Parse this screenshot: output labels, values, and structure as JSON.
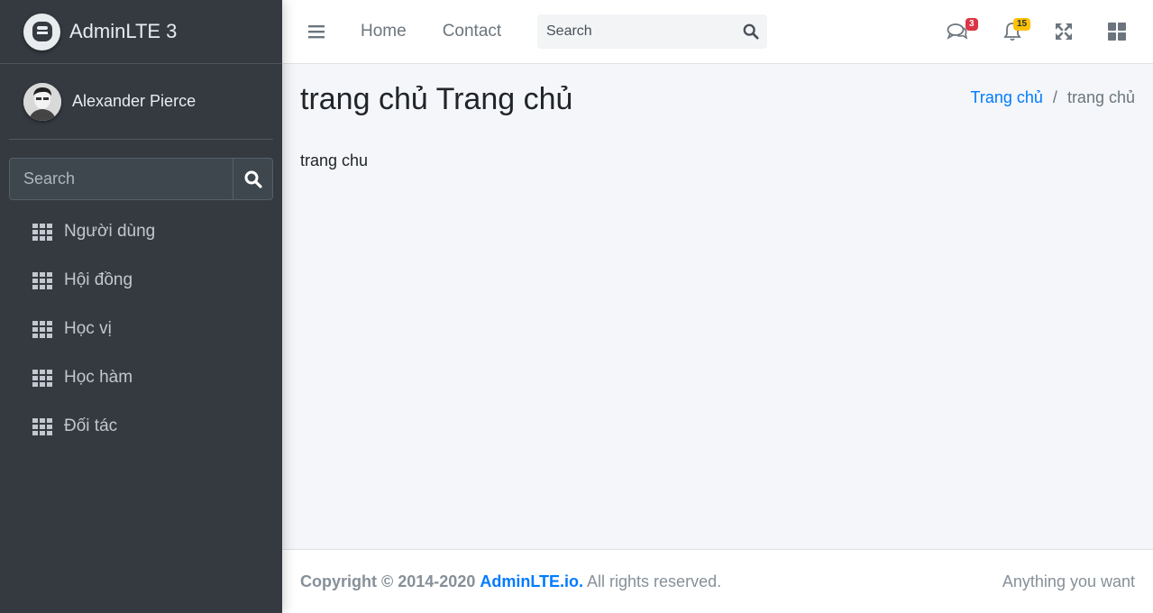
{
  "sidebar": {
    "brand": "AdminLTE 3",
    "user_name": "Alexander Pierce",
    "search_placeholder": "Search",
    "items": [
      {
        "label": "Người dùng",
        "icon": "grid-icon"
      },
      {
        "label": "Hội đồng",
        "icon": "grid-icon"
      },
      {
        "label": "Học vị",
        "icon": "grid-icon"
      },
      {
        "label": "Học hàm",
        "icon": "grid-icon"
      },
      {
        "label": "Đối tác",
        "icon": "grid-icon"
      }
    ]
  },
  "navbar": {
    "links": [
      "Home",
      "Contact"
    ],
    "search_placeholder": "Search",
    "messages_count": "3",
    "notifications_count": "15"
  },
  "content": {
    "title": "trang chủ Trang chủ",
    "breadcrumb": {
      "home": "Trang chủ",
      "current": "trang chủ"
    },
    "body": "trang chu"
  },
  "footer": {
    "copyright": "Copyright © 2014-2020",
    "brand_link": "AdminLTE.io.",
    "rights": "All rights reserved.",
    "right_text": "Anything you want"
  },
  "colors": {
    "sidebar_bg": "#343a40",
    "link": "#007bff",
    "badge_danger": "#dc3545",
    "badge_warning": "#ffc107"
  }
}
